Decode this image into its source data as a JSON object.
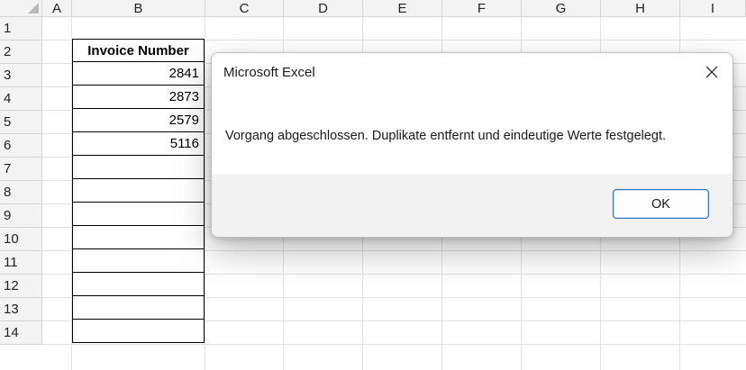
{
  "columns": [
    "A",
    "B",
    "C",
    "D",
    "E",
    "F",
    "G",
    "H",
    "I"
  ],
  "rows": [
    "1",
    "2",
    "3",
    "4",
    "5",
    "6",
    "7",
    "8",
    "9",
    "10",
    "11",
    "12",
    "13",
    "14"
  ],
  "table": {
    "header": "Invoice Number",
    "values": [
      "2841",
      "2873",
      "2579",
      "5116",
      "",
      "",
      "",
      "",
      "",
      "",
      "",
      ""
    ]
  },
  "dialog": {
    "title": "Microsoft Excel",
    "message": "Vorgang abgeschlossen. Duplikate entfernt und eindeutige Werte festgelegt.",
    "ok_label": "OK",
    "close_icon": "close-icon"
  }
}
